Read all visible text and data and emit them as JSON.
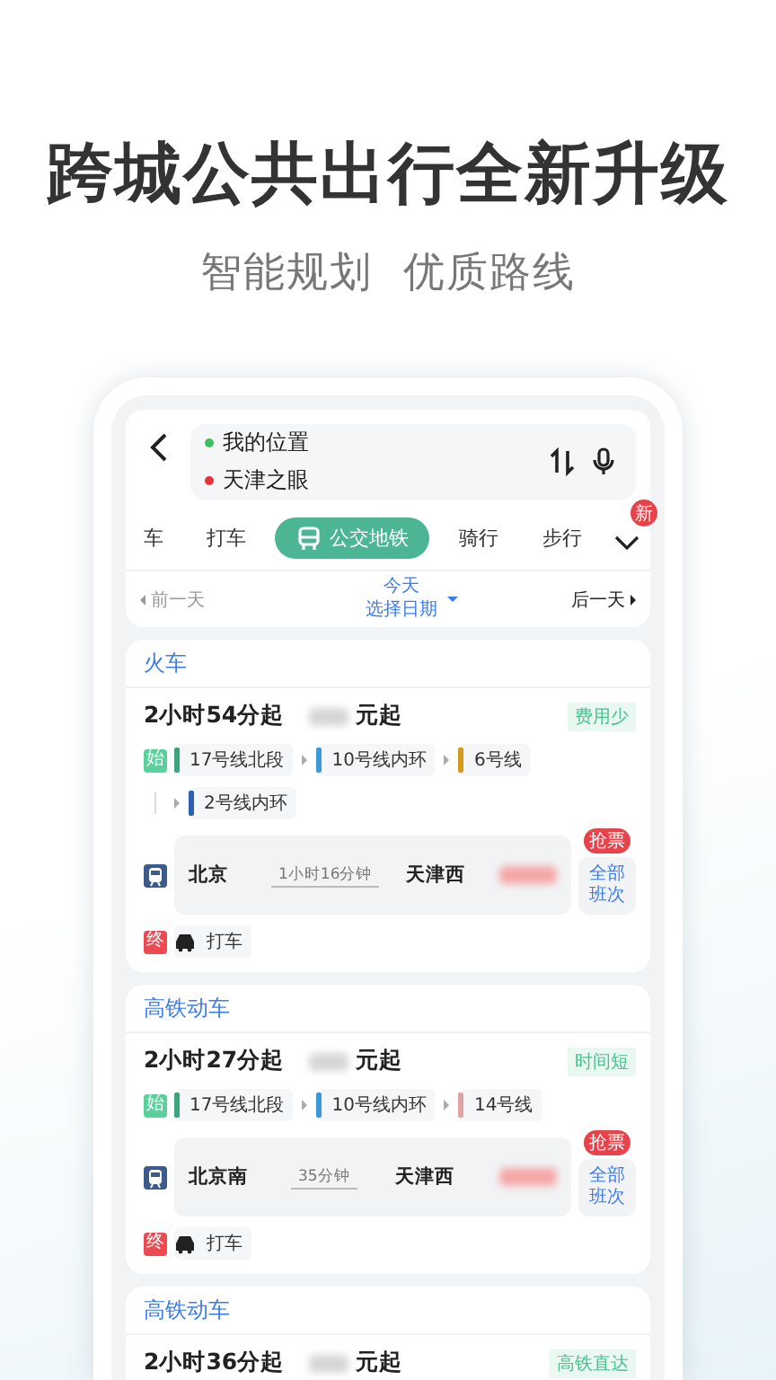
{
  "headline": "跨城公共出行全新升级",
  "subheadline": "智能规划  优质路线",
  "search": {
    "origin": "我的位置",
    "destination": "天津之眼"
  },
  "modes": [
    {
      "label": "车",
      "selected": false
    },
    {
      "label": "打车",
      "selected": false
    },
    {
      "label": "公交地铁",
      "selected": true,
      "kind": "bus"
    },
    {
      "label": "骑行",
      "selected": false
    },
    {
      "label": "步行",
      "selected": false
    }
  ],
  "more_badge": "新",
  "date_bar": {
    "prev": {
      "label": "前一天",
      "disabled": true
    },
    "today": "今天",
    "pick": "选择日期",
    "next": {
      "label": "后一天",
      "disabled": false
    }
  },
  "sections": [
    {
      "title": "火车",
      "duration": "2小时54分起",
      "price_suffix": "元起",
      "tag": "费用少",
      "start_mark": "始",
      "end_mark": "终",
      "segment_rows": [
        {
          "segments": [
            {
              "name": "17号线北段",
              "color": "#3aa57a"
            },
            {
              "name": "10号线内环",
              "color": "#3a9ad9"
            },
            {
              "name": "6号线",
              "color": "#d49a1a"
            }
          ]
        },
        {
          "segments": [
            {
              "name": "2号线内环",
              "color": "#2f5fb3"
            }
          ]
        }
      ],
      "rail": {
        "from": "北京",
        "time": "1小时16分钟",
        "to": "天津西",
        "grab": "抢票",
        "all": "全部班次"
      },
      "taxi": "打车"
    },
    {
      "title": "高铁动车",
      "duration": "2小时27分起",
      "price_suffix": "元起",
      "tag": "时间短",
      "start_mark": "始",
      "end_mark": "终",
      "segment_rows": [
        {
          "segments": [
            {
              "name": "17号线北段",
              "color": "#3aa57a"
            },
            {
              "name": "10号线内环",
              "color": "#3a9ad9"
            },
            {
              "name": "14号线",
              "color": "#e0a3a3"
            }
          ]
        }
      ],
      "rail": {
        "from": "北京南",
        "time": "35分钟",
        "to": "天津西",
        "grab": "抢票",
        "all": "全部班次"
      },
      "taxi": "打车"
    },
    {
      "title": "高铁动车",
      "duration": "2小时36分起",
      "price_suffix": "元起",
      "tag": "高铁直达"
    }
  ]
}
